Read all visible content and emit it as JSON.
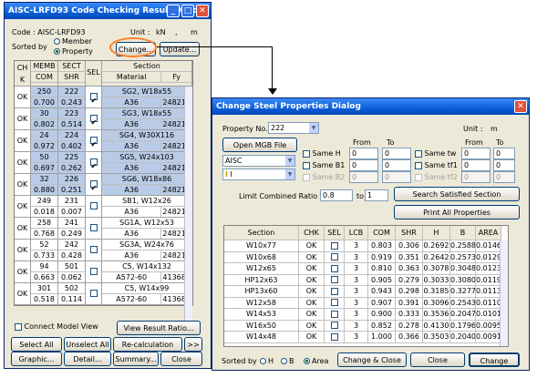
{
  "left": {
    "title": "AISC-LRFD93 Code Checking Result Dialog",
    "code_label": "Code : AISC-LRFD93",
    "unit_label": "Unit :",
    "unit_force": "kN",
    "unit_sep": ",",
    "unit_len": "m",
    "sorted_by": "Sorted by",
    "sort_member": "Member",
    "sort_property": "Property",
    "change_btn": "Change...",
    "update_btn": "Update...",
    "headers": {
      "chk": "CH\nK",
      "memb": "MEMB",
      "sect": "SECT",
      "sel": "SEL",
      "section": "Section",
      "com": "COM",
      "shr": "SHR",
      "material": "Material",
      "fy": "Fy"
    },
    "rows": [
      {
        "chk": "OK",
        "memb": "250",
        "sect": "222",
        "com": "0.700",
        "shr": "0.243",
        "section": "SG2, W18x55",
        "material": "A36",
        "fy": "248211",
        "sel": true,
        "hl": true
      },
      {
        "chk": "OK",
        "memb": "30",
        "sect": "223",
        "com": "0.802",
        "shr": "0.514",
        "section": "SG3, W18x55",
        "material": "A36",
        "fy": "248211",
        "sel": true,
        "hl": true
      },
      {
        "chk": "OK",
        "memb": "24",
        "sect": "224",
        "com": "0.972",
        "shr": "0.402",
        "section": "SG4, W30X116",
        "material": "A36",
        "fy": "248211",
        "sel": true,
        "hl": true
      },
      {
        "chk": "OK",
        "memb": "50",
        "sect": "225",
        "com": "0.697",
        "shr": "0.262",
        "section": "SG5, W24x103",
        "material": "A36",
        "fy": "248211",
        "sel": true,
        "hl": true
      },
      {
        "chk": "OK",
        "memb": "32",
        "sect": "226",
        "com": "0.880",
        "shr": "0.251",
        "section": "SG6, W18x86",
        "material": "A36",
        "fy": "248211",
        "sel": true,
        "hl": true
      },
      {
        "chk": "OK",
        "memb": "249",
        "sect": "231",
        "com": "0.018",
        "shr": "0.007",
        "section": "SB1, W12x26",
        "material": "A36",
        "fy": "248211",
        "sel": false,
        "hl": false
      },
      {
        "chk": "OK",
        "memb": "258",
        "sect": "241",
        "com": "0.768",
        "shr": "0.249",
        "section": "SG1A, W12x53",
        "material": "A36",
        "fy": "248211",
        "sel": false,
        "hl": false
      },
      {
        "chk": "OK",
        "memb": "52",
        "sect": "242",
        "com": "0.733",
        "shr": "0.428",
        "section": "SG3A, W24x76",
        "material": "A36",
        "fy": "248211",
        "sel": false,
        "hl": false
      },
      {
        "chk": "OK",
        "memb": "94",
        "sect": "501",
        "com": "0.663",
        "shr": "0.062",
        "section": "C5, W14x132",
        "material": "A572-60",
        "fy": "413686",
        "sel": false,
        "hl": false
      },
      {
        "chk": "OK",
        "memb": "301",
        "sect": "502",
        "com": "0.518",
        "shr": "0.114",
        "section": "C5, W14x99",
        "material": "A572-60",
        "fy": "413686",
        "sel": false,
        "hl": false
      }
    ],
    "connect_model_view": "Connect Model View",
    "view_result_ratio": "View Result Ratio...",
    "select_all": "Select All",
    "unselect_all": "Unselect All",
    "recalculation": "Re-calculation",
    "more": ">>",
    "graphic": "Graphic...",
    "detail": "Detail...",
    "summary": "Summary...",
    "close": "Close"
  },
  "right": {
    "title": "Change Steel Properties Dialog",
    "property_no_label": "Property No.",
    "property_no": "222",
    "unit_label": "Unit :",
    "unit_val": "m",
    "open_mgb": "Open MGB File",
    "from": "From",
    "to": "To",
    "same_h": "Same H",
    "same_b1": "Same B1",
    "same_b2": "Same B2",
    "same_tw": "Same tw",
    "same_tf1": "Same tf1",
    "same_tf2": "Same tf2",
    "h_from": "0",
    "h_to": "0",
    "b1_from": "0",
    "b1_to": "0",
    "b2_from": "0",
    "b2_to": "0",
    "tw_from": "0",
    "tw_to": "0",
    "tf1_from": "0",
    "tf1_to": "0",
    "tf2_from": "0",
    "tf2_to": "0",
    "db": "AISC",
    "shape": "I",
    "limit_label": "Limit Combined Ratio from",
    "limit_from": "0.8",
    "limit_to_label": "to",
    "limit_to": "1",
    "search_btn": "Search Satisfied Section",
    "print_btn": "Print All Properties",
    "headers": [
      "Section",
      "CHK",
      "SEL",
      "LCB",
      "COM",
      "SHR",
      "H",
      "B",
      "AREA"
    ],
    "rows": [
      [
        "W10x77",
        "OK",
        "",
        "3",
        "0.803",
        "0.306",
        "0.2692",
        "0.2588",
        "0.0146"
      ],
      [
        "W10x68",
        "OK",
        "",
        "3",
        "0.919",
        "0.351",
        "0.2642",
        "0.2573",
        "0.0129"
      ],
      [
        "W12x65",
        "OK",
        "",
        "3",
        "0.810",
        "0.363",
        "0.3078",
        "0.3048",
        "0.0123"
      ],
      [
        "HP12x63",
        "OK",
        "",
        "3",
        "0.905",
        "0.279",
        "0.3033",
        "0.3080",
        "0.0119"
      ],
      [
        "HP13x60",
        "OK",
        "",
        "3",
        "0.943",
        "0.298",
        "0.3185",
        "0.3277",
        "0.0113"
      ],
      [
        "W12x58",
        "OK",
        "",
        "3",
        "0.907",
        "0.391",
        "0.3096",
        "0.2543",
        "0.0110"
      ],
      [
        "W14x53",
        "OK",
        "",
        "3",
        "0.900",
        "0.333",
        "0.3536",
        "0.2047",
        "0.0101"
      ],
      [
        "W16x50",
        "OK",
        "",
        "3",
        "0.852",
        "0.278",
        "0.4130",
        "0.1796",
        "0.0095"
      ],
      [
        "W14x48",
        "OK",
        "",
        "3",
        "1.000",
        "0.366",
        "0.3503",
        "0.2040",
        "0.0091"
      ]
    ],
    "sorted_by": "Sorted by",
    "sort_h": "H",
    "sort_b": "B",
    "sort_area": "Area",
    "change_close": "Change & Close",
    "close": "Close",
    "change": "Change"
  },
  "colors": {
    "highlight": "#b9cbe6",
    "annotation": "#ff7f27"
  }
}
